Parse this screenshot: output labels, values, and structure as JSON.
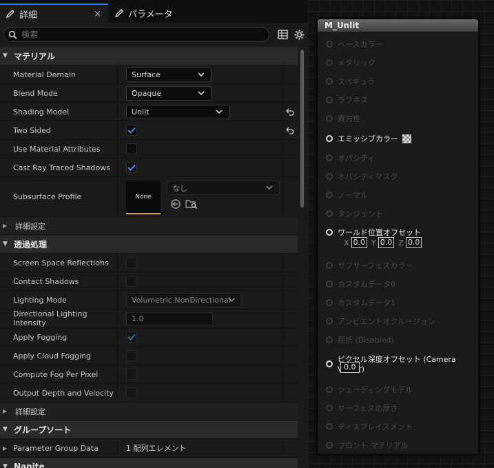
{
  "tabs": [
    {
      "label": "詳細",
      "active": true,
      "close": "×"
    },
    {
      "label": "パラメータ",
      "active": false
    }
  ],
  "search": {
    "placeholder": "検索"
  },
  "sections": {
    "material": "マテリアル",
    "advanced1": "詳細設定",
    "translucency": "透過処理",
    "advanced2": "詳細設定",
    "group_sort": "グループソート",
    "nanite": "Nanite"
  },
  "material": {
    "material_domain": {
      "label": "Material Domain",
      "value": "Surface"
    },
    "blend_mode": {
      "label": "Blend Mode",
      "value": "Opaque"
    },
    "shading_model": {
      "label": "Shading Model",
      "value": "Unlit"
    },
    "two_sided": {
      "label": "Two Sided",
      "checked": true
    },
    "use_material_attributes": {
      "label": "Use Material Attributes",
      "checked": false
    },
    "cast_ray_traced_shadows": {
      "label": "Cast Ray Traced Shadows",
      "checked": true
    },
    "subsurface_profile": {
      "label": "Subsurface Profile",
      "thumb": "None",
      "value": "なし"
    }
  },
  "translucency": {
    "screen_space_reflections": {
      "label": "Screen Space Reflections",
      "checked": false
    },
    "contact_shadows": {
      "label": "Contact Shadows",
      "checked": false
    },
    "lighting_mode": {
      "label": "Lighting Mode",
      "value": "Volumetric NonDirectional"
    },
    "directional_lighting_intensity": {
      "label": "Directional Lighting Intensity",
      "value": "1.0"
    },
    "apply_fogging": {
      "label": "Apply Fogging",
      "checked": true
    },
    "apply_cloud_fogging": {
      "label": "Apply Cloud Fogging",
      "checked": false
    },
    "compute_fog_per_pixel": {
      "label": "Compute Fog Per Pixel",
      "checked": false
    },
    "output_depth_and_velocity": {
      "label": "Output Depth and Velocity",
      "checked": false
    }
  },
  "group_sort": {
    "parameter_group_data": {
      "label": "Parameter Group Data",
      "value": "1 配列エレメント"
    }
  },
  "node": {
    "title": "M_Unlit",
    "pins": [
      {
        "label": "ベースカラー",
        "active": false
      },
      {
        "label": "メタリック",
        "active": false
      },
      {
        "label": "スペキュラ",
        "active": false
      },
      {
        "label": "ラフネス",
        "active": false
      },
      {
        "label": "異方性",
        "active": false
      },
      {
        "label": "エミッシブカラー",
        "active": true
      },
      {
        "label": "オパシティ",
        "active": false
      },
      {
        "label": "オパシティマスク",
        "active": false
      },
      {
        "label": "ノーマル",
        "active": false
      },
      {
        "label": "タンジェント",
        "active": false
      },
      {
        "label": "ワールド位置オフセット",
        "active": true
      },
      {
        "label": "サブサーフェスカラー",
        "active": false
      },
      {
        "label": "カスタムデータ0",
        "active": false
      },
      {
        "label": "カスタムデータ1",
        "active": false
      },
      {
        "label": "アンビエントオクルージョン",
        "active": false
      },
      {
        "label": "屈折 (Disabled)",
        "active": false
      },
      {
        "label": "ピクセル深度オフセット (Camera Vector)",
        "active": true
      },
      {
        "label": "シェーディングモデル",
        "active": false
      },
      {
        "label": "サーフェスの厚さ",
        "active": false
      },
      {
        "label": "ディスプレイスメント",
        "active": false
      },
      {
        "label": "フロント マテリアル",
        "active": false
      }
    ],
    "wpo": {
      "x_label": "X",
      "x": "0.0",
      "y_label": "Y",
      "y": "0.0",
      "z_label": "Z",
      "z": "0.0"
    },
    "pdo": {
      "value": "0.0"
    }
  },
  "colors": {
    "accent": "#2b7bd9",
    "panel": "#1a1a1a",
    "section": "#2a2a2a",
    "graph": "#131313"
  }
}
